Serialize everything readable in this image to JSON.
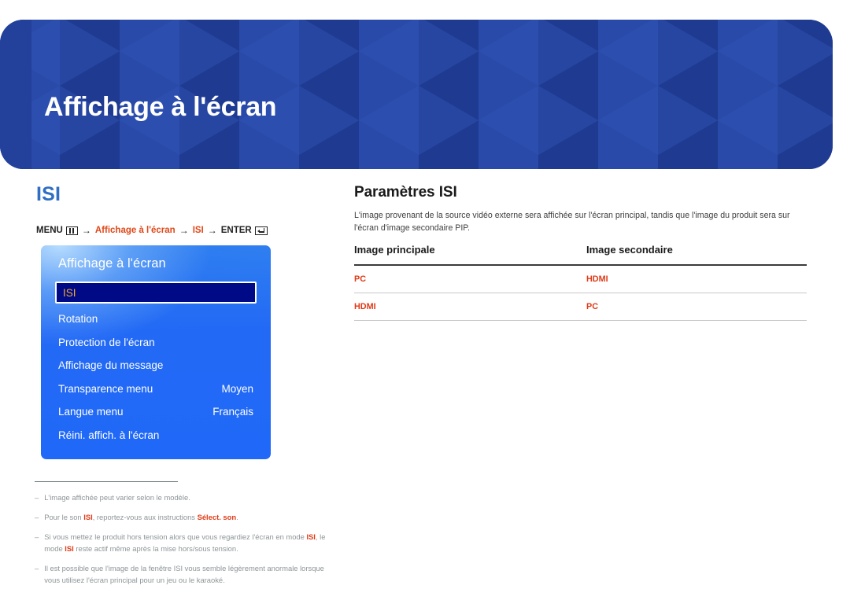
{
  "header": {
    "title": "Affichage à l'écran",
    "background_color": "#23409a"
  },
  "left": {
    "section_title": "ISI",
    "section_title_color": "#2f6ec4",
    "menu_path": {
      "menu_label": "MENU",
      "menu_icon": "menu-grid-icon",
      "arrow1": "→",
      "step1": "Affichage à l'écran",
      "arrow2": "→",
      "step2": "ISI",
      "arrow3": "→",
      "enter_label": "ENTER",
      "enter_icon": "enter-key-icon",
      "accent_color": "#e04718"
    },
    "osd": {
      "title": "Affichage à l'écran",
      "selected_index": 0,
      "selected_color": "#f0a830",
      "items": [
        {
          "label": "ISI",
          "value": ""
        },
        {
          "label": "Rotation",
          "value": ""
        },
        {
          "label": "Protection de l'écran",
          "value": ""
        },
        {
          "label": "Affichage du message",
          "value": ""
        },
        {
          "label": "Transparence menu",
          "value": "Moyen"
        },
        {
          "label": "Langue menu",
          "value": "Français"
        },
        {
          "label": "Réini. affich. à l'écran",
          "value": ""
        }
      ]
    },
    "notes": [
      {
        "dash": "–",
        "parts": [
          {
            "t": "L'image affichée peut varier selon le modèle.",
            "hot": false
          }
        ]
      },
      {
        "dash": "–",
        "parts": [
          {
            "t": "Pour le son ",
            "hot": false
          },
          {
            "t": "ISI",
            "hot": true
          },
          {
            "t": ", reportez-vous aux instructions ",
            "hot": false
          },
          {
            "t": "Sélect. son",
            "hot": true
          },
          {
            "t": ".",
            "hot": false
          }
        ]
      },
      {
        "dash": "–",
        "parts": [
          {
            "t": "Si vous mettez le produit hors tension alors que vous regardiez l'écran en mode ",
            "hot": false
          },
          {
            "t": "ISI",
            "hot": true
          },
          {
            "t": ", le mode ",
            "hot": false
          },
          {
            "t": "ISI",
            "hot": true
          },
          {
            "t": " reste actif même après la mise hors/sous tension.",
            "hot": false
          }
        ]
      },
      {
        "dash": "–",
        "parts": [
          {
            "t": "Il est possible que l'image de la fenêtre ISI vous semble légèrement anormale lorsque vous utilisez l'écran principal pour un jeu ou le karaoké.",
            "hot": false
          }
        ]
      }
    ]
  },
  "right": {
    "title": "Paramètres ISI",
    "description": "L'image provenant de la source vidéo externe sera affichée sur l'écran principal, tandis que l'image du produit sera sur l'écran d'image secondaire PIP.",
    "table": {
      "headers": [
        "Image principale",
        "Image secondaire"
      ],
      "rows": [
        [
          "PC",
          "HDMI"
        ],
        [
          "HDMI",
          "PC"
        ]
      ],
      "value_color": "#e03a16"
    }
  }
}
